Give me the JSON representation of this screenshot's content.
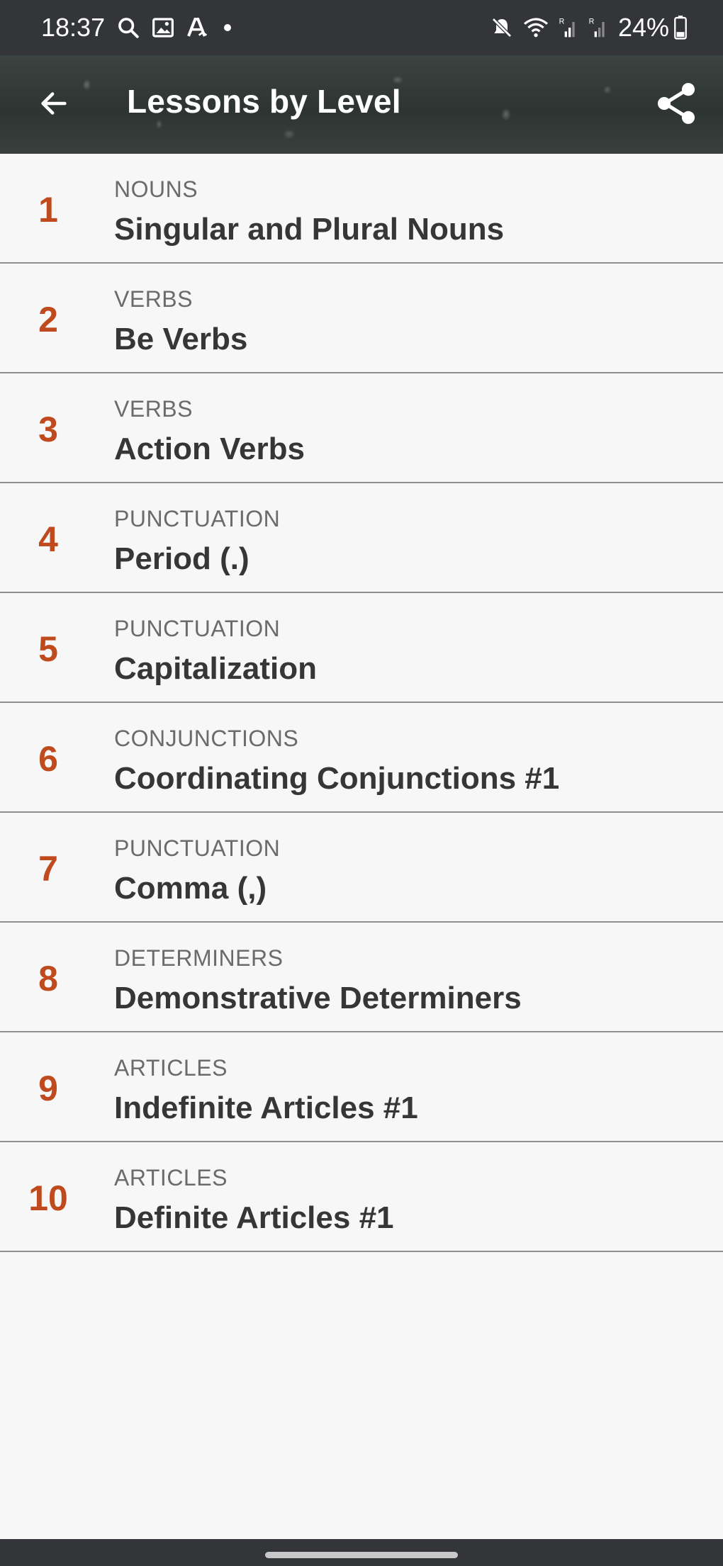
{
  "status_bar": {
    "time": "18:37",
    "left_icons": [
      "search-icon",
      "image-icon",
      "a-icon"
    ],
    "right_icons": [
      "mute-icon",
      "wifi-icon",
      "signal-icon",
      "signal-icon"
    ],
    "battery_percent": "24%"
  },
  "app_bar": {
    "title": "Lessons by Level"
  },
  "lessons": [
    {
      "number": "1",
      "category": "NOUNS",
      "title": "Singular and Plural Nouns"
    },
    {
      "number": "2",
      "category": "VERBS",
      "title": "Be Verbs"
    },
    {
      "number": "3",
      "category": "VERBS",
      "title": "Action Verbs"
    },
    {
      "number": "4",
      "category": "PUNCTUATION",
      "title": "Period (.)"
    },
    {
      "number": "5",
      "category": "PUNCTUATION",
      "title": "Capitalization"
    },
    {
      "number": "6",
      "category": "CONJUNCTIONS",
      "title": "Coordinating Conjunctions #1"
    },
    {
      "number": "7",
      "category": "PUNCTUATION",
      "title": "Comma (,)"
    },
    {
      "number": "8",
      "category": "DETERMINERS",
      "title": "Demonstrative Determiners"
    },
    {
      "number": "9",
      "category": "ARTICLES",
      "title": "Indefinite Articles #1"
    },
    {
      "number": "10",
      "category": "ARTICLES",
      "title": "Definite Articles #1"
    }
  ],
  "colors": {
    "accent_number": "#bf4a1e",
    "title_text": "#363636",
    "category_text": "#6b6b6b",
    "background": "#f7f7f7"
  }
}
